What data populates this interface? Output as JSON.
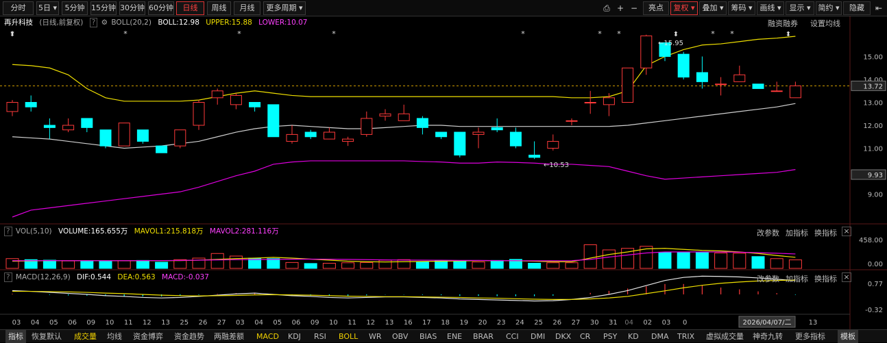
{
  "periods": [
    "分时",
    "5日",
    "5分钟",
    "15分钟",
    "30分钟",
    "60分钟",
    "日线",
    "周线",
    "月线",
    "更多周期"
  ],
  "active_period": "日线",
  "toolbar": [
    "亮点",
    "复权",
    "叠加",
    "筹码",
    "画线",
    "显示",
    "简约",
    "隐藏"
  ],
  "stock": {
    "name": "再升科技",
    "mode": "(日线,前复权)",
    "indicator": "BOLL(20,2)",
    "boll": "BOLL:12.98",
    "upper": "UPPER:15.88",
    "lower": "LOWER:10.07"
  },
  "main_right": [
    "融资融券",
    "设置均线"
  ],
  "price_labels": {
    "p15": "15.00",
    "p14": "14.00",
    "p13": "13.00",
    "p12": "12.00",
    "p11": "11.00",
    "p10": "9.93",
    "p9": "9.00",
    "current": "13.72"
  },
  "annotations": {
    "high": "15.95",
    "low": "10.53"
  },
  "vol": {
    "name": "VOL(5,10)",
    "volume": "VOLUME:165.655万",
    "mavol1": "MAVOL1:215.818万",
    "mavol2": "MAVOL2:281.116万",
    "axis_top": "458.00",
    "axis_bottom": "0.00"
  },
  "macd": {
    "name": "MACD(12,26,9)",
    "dif": "DIF:0.544",
    "dea": "DEA:0.563",
    "macd": "MACD:-0.037",
    "axis_top": "0.77",
    "axis_bottom": "-0.32"
  },
  "sub_actions": [
    "改参数",
    "加指标",
    "换指标"
  ],
  "dates": [
    "03",
    "04",
    "05",
    "06",
    "09",
    "10",
    "11",
    "12",
    "13",
    "25",
    "26",
    "27",
    "03",
    "04",
    "05",
    "06",
    "09",
    "10",
    "11",
    "12",
    "13",
    "16",
    "17",
    "18",
    "19",
    "20",
    "23",
    "24",
    "25",
    "26",
    "27",
    "30",
    "31",
    "04",
    "02",
    "03",
    "0",
    "13"
  ],
  "date_tip": "2026/04/07/二",
  "bottom": [
    "指标",
    "恢复默认",
    "成交量",
    "均线",
    "资金博弈",
    "资金趋势",
    "两融差额",
    "MACD",
    "KDJ",
    "RSI",
    "BOLL",
    "WR",
    "OBV",
    "BIAS",
    "ENE",
    "BRAR",
    "CCI",
    "DMI",
    "DKX",
    "CR",
    "PSY",
    "KD",
    "DMA",
    "TRIX",
    "虚拟成交量",
    "神奇九转",
    "更多指标",
    "模板"
  ],
  "colors": {
    "up": "#ff3a3a",
    "down": "#00ffff",
    "boll_mid": "#d0d0d0",
    "upper": "#f0e000",
    "lower": "#e000e0"
  },
  "chart_data": {
    "type": "candlestick",
    "candles": [
      [
        12.6,
        13.0,
        12.4,
        13.1
      ],
      [
        13.0,
        12.8,
        12.6,
        13.3
      ],
      [
        12.0,
        11.9,
        11.4,
        12.3
      ],
      [
        11.8,
        12.0,
        11.7,
        12.3
      ],
      [
        12.3,
        11.9,
        11.7,
        12.3
      ],
      [
        11.8,
        11.1,
        11.0,
        11.8
      ],
      [
        11.1,
        12.1,
        11.1,
        12.1
      ],
      [
        11.8,
        11.3,
        11.2,
        11.8
      ],
      [
        11.1,
        10.8,
        10.8,
        11.1
      ],
      [
        11.1,
        11.8,
        11.0,
        11.8
      ],
      [
        12.0,
        13.0,
        11.8,
        13.1
      ],
      [
        13.2,
        13.5,
        12.9,
        13.6
      ],
      [
        12.9,
        13.3,
        12.7,
        13.4
      ],
      [
        13.0,
        12.8,
        12.6,
        13.0
      ],
      [
        12.9,
        11.5,
        11.5,
        12.9
      ],
      [
        11.3,
        11.6,
        11.2,
        12.0
      ],
      [
        11.7,
        11.5,
        11.4,
        11.8
      ],
      [
        11.4,
        11.7,
        11.4,
        11.9
      ],
      [
        11.3,
        11.4,
        11.1,
        11.5
      ],
      [
        11.6,
        12.3,
        11.5,
        12.6
      ],
      [
        12.4,
        12.5,
        12.2,
        12.7
      ],
      [
        12.2,
        12.5,
        12.2,
        12.9
      ],
      [
        12.3,
        11.9,
        11.6,
        12.4
      ],
      [
        11.7,
        11.5,
        11.4,
        11.7
      ],
      [
        11.7,
        10.7,
        10.6,
        11.7
      ],
      [
        11.6,
        11.7,
        11.0,
        11.9
      ],
      [
        11.9,
        11.8,
        11.7,
        12.3
      ],
      [
        11.7,
        11.1,
        11.0,
        11.9
      ],
      [
        10.7,
        10.6,
        10.53,
        11.3
      ],
      [
        11.0,
        11.3,
        10.9,
        11.6
      ],
      [
        12.2,
        12.2,
        12.0,
        12.3
      ],
      [
        13.0,
        13.0,
        12.5,
        13.5
      ],
      [
        12.9,
        13.2,
        12.4,
        13.4
      ],
      [
        13.0,
        14.5,
        13.0,
        14.5
      ],
      [
        14.5,
        15.9,
        14.2,
        15.95
      ],
      [
        15.6,
        15.0,
        14.8,
        15.6
      ],
      [
        15.1,
        14.1,
        14.0,
        15.2
      ],
      [
        14.3,
        13.9,
        13.6,
        15.0
      ],
      [
        13.8,
        13.8,
        13.3,
        14.1
      ],
      [
        13.9,
        14.2,
        13.9,
        14.6
      ],
      [
        13.8,
        13.6,
        13.6,
        13.8
      ],
      [
        13.5,
        13.5,
        13.5,
        13.9
      ],
      [
        13.2,
        13.72,
        13.2,
        13.9
      ]
    ],
    "boll_mid": [
      11.5,
      11.45,
      11.4,
      11.3,
      11.2,
      11.1,
      11.0,
      11.05,
      11.1,
      11.2,
      11.3,
      11.5,
      11.7,
      11.85,
      11.95,
      12.0,
      11.95,
      11.9,
      11.85,
      11.85,
      11.9,
      11.95,
      12.0,
      12.0,
      11.95,
      11.95,
      11.95,
      11.95,
      11.95,
      11.95,
      11.95,
      11.95,
      11.95,
      12.0,
      12.1,
      12.2,
      12.3,
      12.4,
      12.5,
      12.6,
      12.7,
      12.8,
      12.95
    ],
    "upper": [
      14.65,
      14.6,
      14.5,
      14.2,
      13.6,
      13.2,
      13.05,
      13.05,
      13.05,
      13.05,
      13.1,
      13.25,
      13.4,
      13.5,
      13.4,
      13.3,
      13.25,
      13.25,
      13.25,
      13.25,
      13.25,
      13.25,
      13.25,
      13.25,
      13.25,
      13.25,
      13.25,
      13.25,
      13.25,
      13.25,
      13.2,
      13.2,
      13.25,
      13.5,
      14.6,
      15.0,
      15.3,
      15.5,
      15.55,
      15.65,
      15.75,
      15.8,
      15.88
    ],
    "lower": [
      8.0,
      8.3,
      8.4,
      8.5,
      8.6,
      8.7,
      8.8,
      8.9,
      9.0,
      9.1,
      9.3,
      9.55,
      9.8,
      10.0,
      10.3,
      10.4,
      10.45,
      10.45,
      10.45,
      10.45,
      10.45,
      10.45,
      10.42,
      10.4,
      10.35,
      10.35,
      10.4,
      10.38,
      10.35,
      10.3,
      10.3,
      10.25,
      10.2,
      10.0,
      9.8,
      9.65,
      9.7,
      9.75,
      9.8,
      9.85,
      9.9,
      9.95,
      10.07
    ],
    "volume": [
      190,
      170,
      160,
      145,
      150,
      145,
      150,
      155,
      120,
      170,
      200,
      290,
      240,
      200,
      190,
      115,
      95,
      100,
      110,
      115,
      160,
      170,
      130,
      155,
      140,
      125,
      155,
      175,
      100,
      110,
      110,
      460,
      360,
      390,
      430,
      310,
      320,
      310,
      300,
      295,
      230,
      190,
      165.655
    ],
    "mavol1": [
      140,
      145,
      150,
      150,
      152,
      150,
      148,
      150,
      148,
      152,
      160,
      175,
      190,
      200,
      215,
      200,
      180,
      160,
      140,
      130,
      125,
      130,
      135,
      140,
      145,
      150,
      150,
      148,
      140,
      130,
      128,
      200,
      270,
      320,
      380,
      390,
      370,
      350,
      340,
      320,
      290,
      250,
      215.818
    ],
    "mavol2": [
      150,
      150,
      152,
      150,
      150,
      150,
      150,
      152,
      152,
      155,
      160,
      165,
      170,
      172,
      175,
      178,
      180,
      178,
      175,
      170,
      165,
      162,
      160,
      158,
      155,
      155,
      152,
      150,
      148,
      148,
      150,
      175,
      220,
      260,
      300,
      320,
      320,
      320,
      320,
      315,
      305,
      295,
      281.116
    ],
    "dif": [
      0.15,
      0.12,
      0.08,
      0.04,
      0.0,
      -0.05,
      -0.08,
      -0.12,
      -0.14,
      -0.12,
      -0.08,
      -0.03,
      0.02,
      0.05,
      0.0,
      -0.05,
      -0.08,
      -0.12,
      -0.14,
      -0.12,
      -0.1,
      -0.1,
      -0.12,
      -0.14,
      -0.18,
      -0.2,
      -0.22,
      -0.24,
      -0.26,
      -0.25,
      -0.2,
      -0.12,
      0.0,
      0.15,
      0.35,
      0.55,
      0.67,
      0.72,
      0.71,
      0.69,
      0.65,
      0.6,
      0.544
    ],
    "dea": [
      0.12,
      0.12,
      0.11,
      0.1,
      0.08,
      0.05,
      0.03,
      0.0,
      -0.03,
      -0.05,
      -0.06,
      -0.05,
      -0.04,
      -0.02,
      -0.01,
      -0.02,
      -0.03,
      -0.05,
      -0.07,
      -0.08,
      -0.09,
      -0.09,
      -0.1,
      -0.11,
      -0.12,
      -0.14,
      -0.15,
      -0.17,
      -0.19,
      -0.2,
      -0.2,
      -0.18,
      -0.14,
      -0.08,
      0.03,
      0.14,
      0.26,
      0.36,
      0.44,
      0.49,
      0.53,
      0.55,
      0.563
    ],
    "macd_bars": [
      0.05,
      0.0,
      -0.04,
      -0.08,
      -0.1,
      -0.12,
      -0.14,
      -0.16,
      -0.16,
      -0.1,
      -0.04,
      0.04,
      0.1,
      0.14,
      0.02,
      -0.06,
      -0.1,
      -0.14,
      -0.14,
      -0.08,
      -0.02,
      -0.02,
      -0.04,
      -0.06,
      -0.12,
      -0.12,
      -0.14,
      -0.14,
      -0.14,
      -0.1,
      0.0,
      0.12,
      0.28,
      0.46,
      0.64,
      0.82,
      0.82,
      0.72,
      0.54,
      0.4,
      0.24,
      0.1,
      -0.037
    ]
  }
}
